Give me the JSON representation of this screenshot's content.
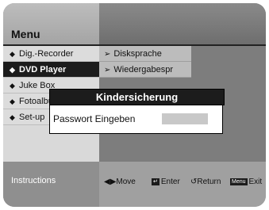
{
  "menu": {
    "title": "Menu"
  },
  "main_items": [
    {
      "label": "Dig.-Recorder",
      "icon": "diamond-icon",
      "active": false
    },
    {
      "label": "DVD Player",
      "icon": "diamond-icon",
      "active": true
    },
    {
      "label": "Juke Box",
      "icon": "diamond-icon",
      "active": false
    },
    {
      "label": "Fotoalbum",
      "icon": "diamond-icon",
      "active": false
    },
    {
      "label": "Set-up",
      "icon": "diamond-icon",
      "active": false
    }
  ],
  "sub_items": [
    {
      "label": "Disksprache",
      "icon": "arrow-right-icon"
    },
    {
      "label": "Wiedergabespr",
      "icon": "arrow-right-icon"
    }
  ],
  "dialog": {
    "title": "Kindersicherung",
    "password_label": "Passwort Eingeben"
  },
  "footer": {
    "instructions": "Instructions",
    "hints": [
      {
        "key": "",
        "label": "Move"
      },
      {
        "key": "",
        "label": "Enter"
      },
      {
        "key": "",
        "label": "Return"
      },
      {
        "key": "Menu",
        "label": "Exit"
      }
    ]
  }
}
